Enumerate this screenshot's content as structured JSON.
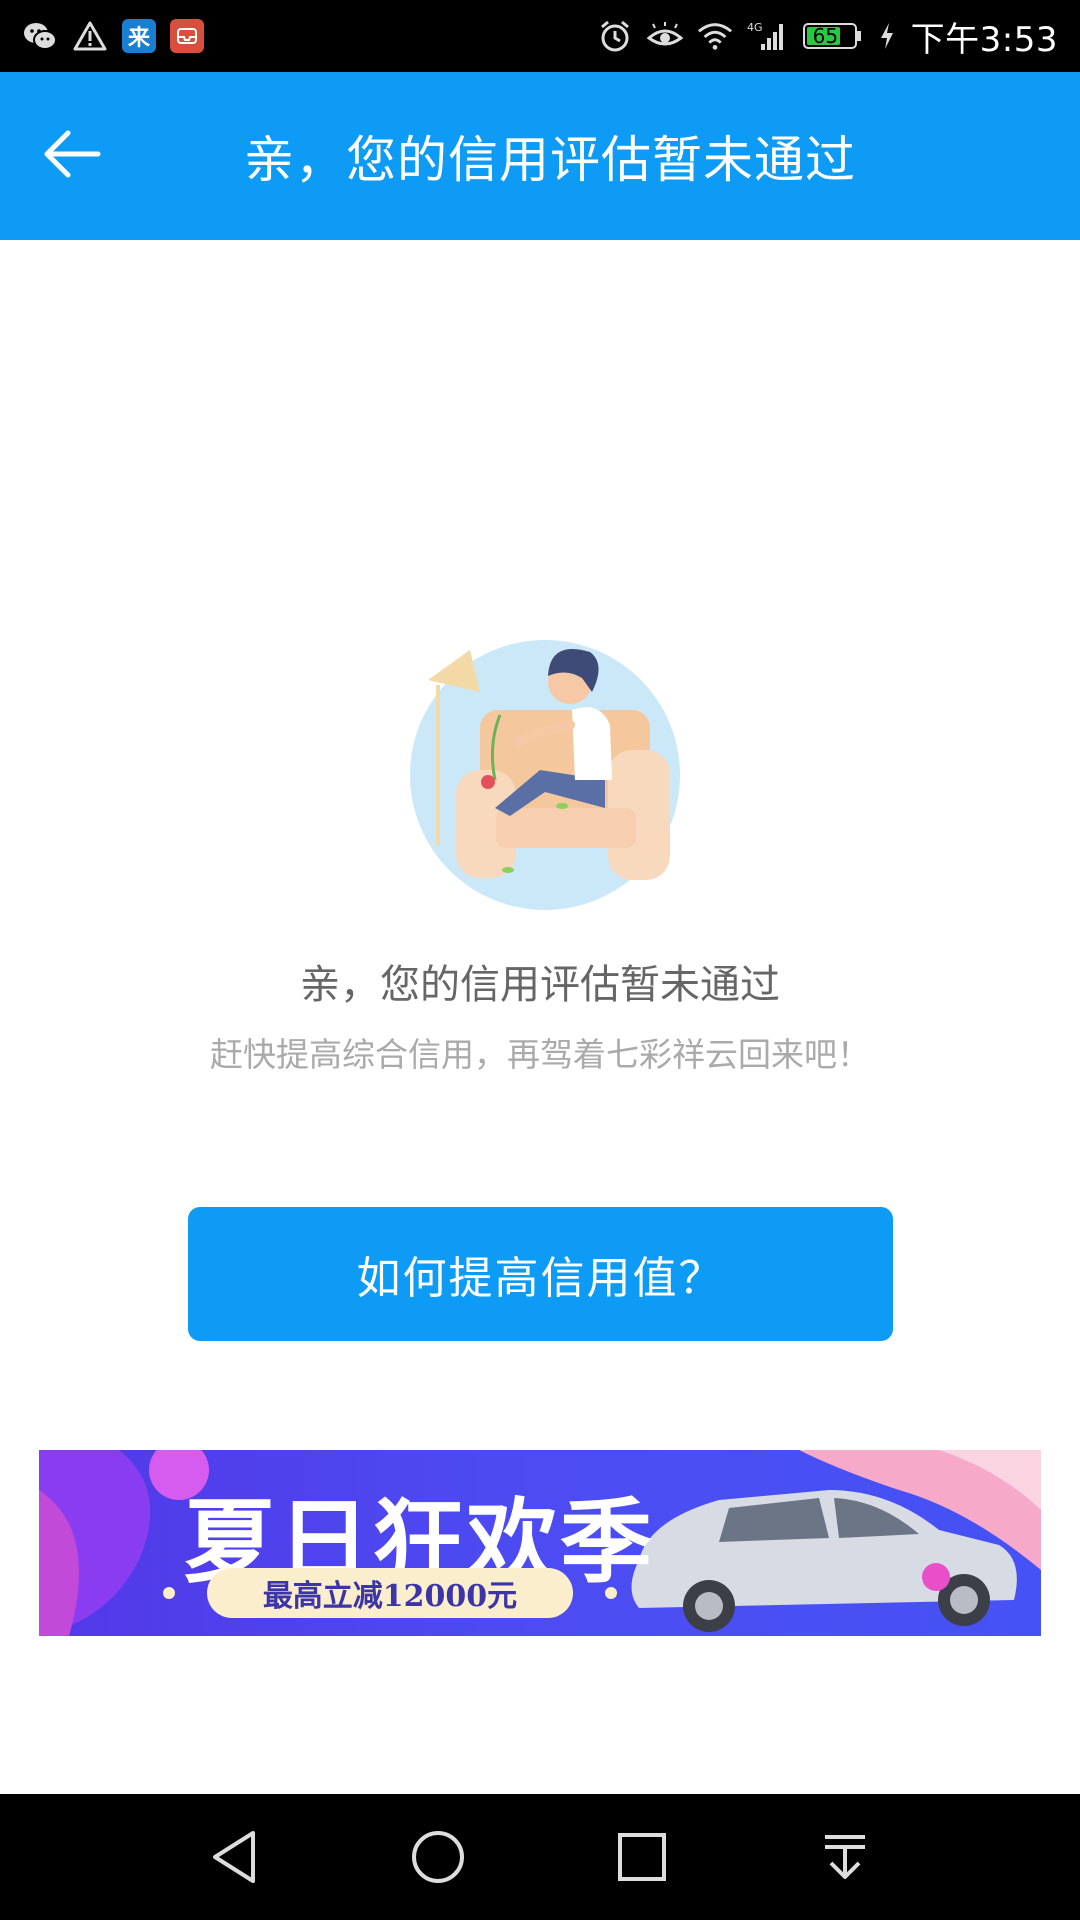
{
  "status_bar": {
    "time": "下午3:53",
    "battery": "65",
    "network": "4G",
    "app_icons": [
      {
        "name": "wechat-icon"
      },
      {
        "name": "warning-icon"
      },
      {
        "name": "lai-app-icon",
        "label": "来",
        "color": "#1a7fd1"
      },
      {
        "name": "inbox-app-icon",
        "color": "#d94f3d"
      }
    ]
  },
  "header": {
    "title": "亲，您的信用评估暂未通过",
    "background": "#0E9BF5"
  },
  "message": {
    "title": "亲，您的信用评估暂未通过",
    "subtitle": "赶快提高综合信用，再驾着七彩祥云回来吧！"
  },
  "cta": {
    "label": "如何提高信用值？"
  },
  "banner": {
    "headline": "夏日狂欢季",
    "tagline": "最高立减12000元"
  },
  "colors": {
    "accent": "#0E9BF5",
    "text_primary": "#666666",
    "text_secondary": "#aaaaaa"
  }
}
